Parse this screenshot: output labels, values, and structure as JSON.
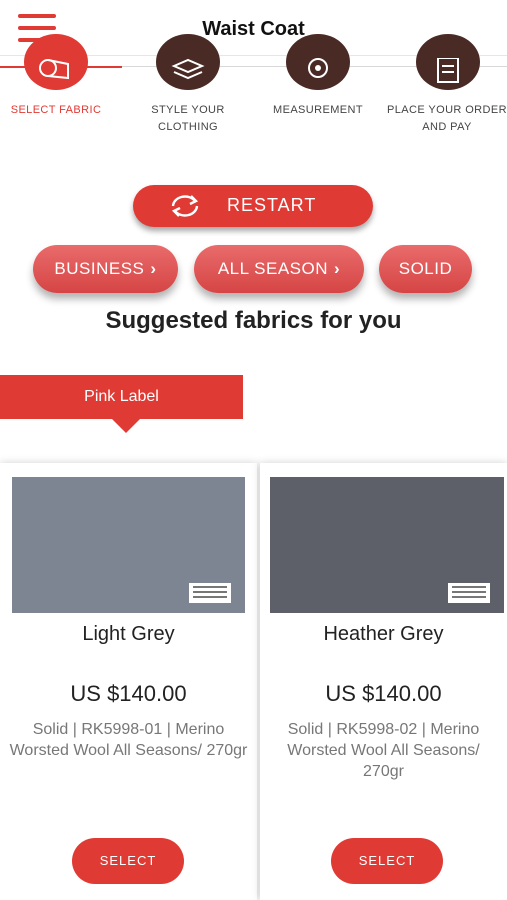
{
  "header": {
    "title": "Waist Coat"
  },
  "steps": [
    {
      "label": "SELECT FABRIC",
      "active": true
    },
    {
      "label": "STYLE YOUR CLOTHING",
      "active": false
    },
    {
      "label": "MEASUREMENT",
      "active": false
    },
    {
      "label": "PLACE YOUR ORDER AND PAY",
      "active": false
    }
  ],
  "restart": {
    "label": "RESTART"
  },
  "filters": [
    {
      "label": "BUSINESS"
    },
    {
      "label": "ALL SEASON"
    },
    {
      "label": "SOLID"
    }
  ],
  "heading": "Suggested fabrics for you",
  "ribbon": "Pink Label",
  "products": [
    {
      "name": "Light Grey",
      "price": "US $140.00",
      "description": "Solid | RK5998-01 | Merino Worsted Wool All Seasons/ 270gr",
      "swatch_color": "#7e8592",
      "select_label": "SELECT"
    },
    {
      "name": "Heather Grey",
      "price": "US $140.00",
      "description": "Solid | RK5998-02 | Merino Worsted Wool All Seasons/ 270gr",
      "swatch_color": "#5d6069",
      "select_label": "SELECT"
    }
  ],
  "colors": {
    "accent": "#e03a34",
    "step_icon_bg": "#4a2a24"
  }
}
